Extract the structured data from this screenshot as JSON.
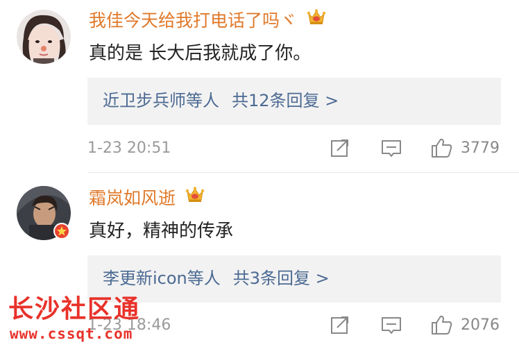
{
  "comments": [
    {
      "username": "我佳今天给我打电话了吗ヾ",
      "text": "真的是 长大后我就成了你。",
      "replies": {
        "who": "近卫步兵师等人",
        "count": "共12条回复 >"
      },
      "timestamp": "1-23 20:51",
      "likes": "3779",
      "icons": [
        "crown-badge",
        "share-icon",
        "comment-icon",
        "like-icon"
      ]
    },
    {
      "username": "霜岚如风逝",
      "text": "真好，精神的传承",
      "replies": {
        "who": "李更新icon等人",
        "count": "共3条回复 >"
      },
      "timestamp": "1-23 18:46",
      "likes": "2076",
      "icons": [
        "crown-badge",
        "star-badge",
        "share-icon",
        "comment-icon",
        "like-icon"
      ]
    }
  ],
  "watermark": {
    "title": "长沙社区通",
    "url": "www.cssqt.com"
  },
  "colors": {
    "username": "#e0792a",
    "reply_link": "#4c6a93",
    "reply_bg": "#f2f2f2",
    "meta": "#9a9a9a",
    "watermark": "#e8322a",
    "crown": "#f2b230"
  }
}
